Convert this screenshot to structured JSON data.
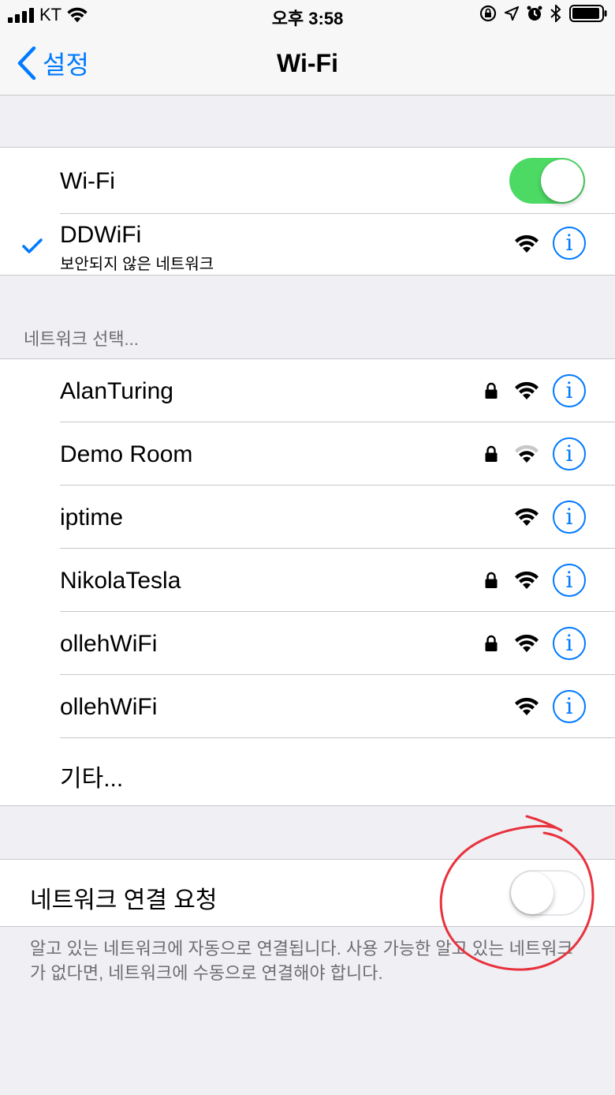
{
  "status_bar": {
    "carrier": "KT",
    "time": "오후 3:58"
  },
  "nav": {
    "back_label": "설정",
    "title": "Wi-Fi"
  },
  "wifi_section": {
    "wifi_label": "Wi-Fi",
    "wifi_enabled": true,
    "connected_network": {
      "name": "DDWiFi",
      "subtitle": "보안되지 않은 네트워크"
    }
  },
  "choose_network": {
    "header": "네트워크 선택...",
    "networks": [
      {
        "name": "AlanTuring",
        "locked": true,
        "signal": "strong"
      },
      {
        "name": "Demo Room",
        "locked": true,
        "signal": "weak"
      },
      {
        "name": "iptime",
        "locked": false,
        "signal": "strong"
      },
      {
        "name": "NikolaTesla",
        "locked": true,
        "signal": "strong"
      },
      {
        "name": "ollehWiFi",
        "locked": true,
        "signal": "strong"
      },
      {
        "name": "ollehWiFi",
        "locked": false,
        "signal": "strong"
      }
    ],
    "other_label": "기타..."
  },
  "ask_to_join": {
    "label": "네트워크 연결 요청",
    "enabled": false,
    "footer": "알고 있는 네트워크에 자동으로 연결됩니다. 사용 가능한 알고 있는 네트워크가 없다면, 네트워크에 수동으로 연결해야 합니다."
  },
  "colors": {
    "accent": "#007aff",
    "toggle_on": "#4cd964",
    "annotation": "#e8323c"
  },
  "icons": [
    "signal-bars-icon",
    "wifi-status-icon",
    "rotation-lock-icon",
    "location-arrow-icon",
    "alarm-icon",
    "bluetooth-icon",
    "battery-icon",
    "chevron-left-icon",
    "checkmark-icon",
    "wifi-icon",
    "lock-icon",
    "info-icon"
  ]
}
